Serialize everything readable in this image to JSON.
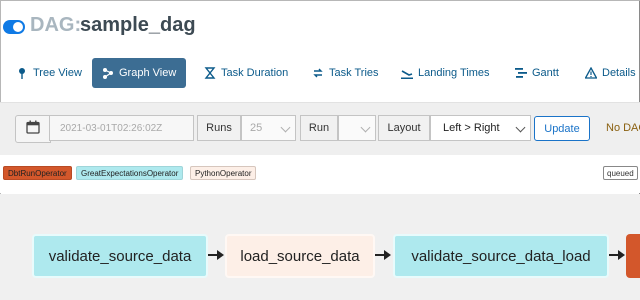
{
  "header": {
    "dag_prefix": "DAG:",
    "dag_name": "sample_dag"
  },
  "nav": [
    {
      "label": "Tree View",
      "icon": "tree-icon",
      "active": false
    },
    {
      "label": "Graph View",
      "icon": "graph-icon",
      "active": true
    },
    {
      "label": "Task Duration",
      "icon": "hourglass-icon",
      "active": false
    },
    {
      "label": "Task Tries",
      "icon": "retry-icon",
      "active": false
    },
    {
      "label": "Landing Times",
      "icon": "landing-icon",
      "active": false
    },
    {
      "label": "Gantt",
      "icon": "gantt-icon",
      "active": false
    },
    {
      "label": "Details",
      "icon": "warning-icon",
      "active": false
    }
  ],
  "toolbar": {
    "date_value": "2021-03-01T02:26:02Z",
    "runs_label": "Runs",
    "runs_value": "25",
    "run_label": "Run",
    "run_value": "",
    "layout_label": "Layout",
    "layout_value": "Left > Right",
    "update_label": "Update",
    "status_text": "No DAG"
  },
  "legend": {
    "operators": [
      {
        "label": "DbtRunOperator",
        "color": "#d3572b"
      },
      {
        "label": "GreatExpectationsOperator",
        "color": "#aee9ee"
      },
      {
        "label": "PythonOperator",
        "color": "#fdefe7"
      }
    ],
    "state_queued": "queued"
  },
  "graph": {
    "nodes": [
      {
        "label": "validate_source_data",
        "color": "#aee9ee"
      },
      {
        "label": "load_source_data",
        "color": "#fdefe7"
      },
      {
        "label": "validate_source_data_load",
        "color": "#aee9ee"
      },
      {
        "label": "",
        "color": "#d3572b"
      }
    ]
  },
  "colors": {
    "accent": "#3c6d93",
    "link": "#0b5a8a",
    "toggle": "#0f7ae5",
    "update": "#1a73c8"
  }
}
